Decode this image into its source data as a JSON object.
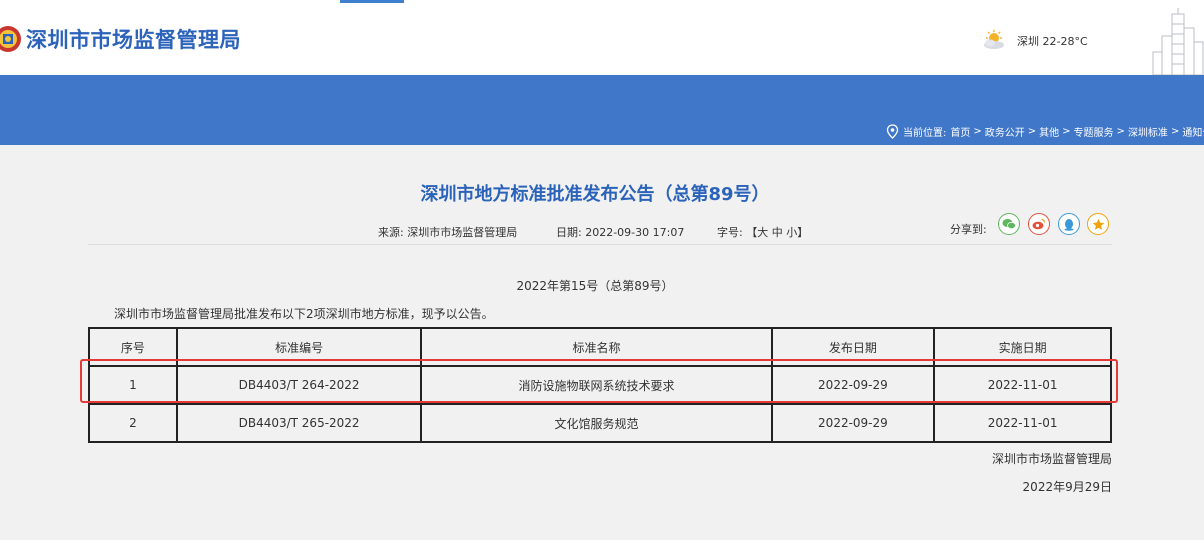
{
  "header": {
    "site_title": "深圳市市场监督管理局",
    "weather": "深圳 22-28°C"
  },
  "breadcrumb": {
    "label": "当前位置:",
    "items": [
      "首页",
      "政务公开",
      "其他",
      "专题服务",
      "深圳标准",
      "通知公告"
    ],
    "separator": ">"
  },
  "article": {
    "title": "深圳市地方标准批准发布公告（总第89号）",
    "source": "来源:  深圳市市场监督管理局",
    "date": "日期:  2022-09-30 17:07",
    "font_size_label": "字号:  【大   中   小】",
    "share_label": "分享到:",
    "issue": "2022年第15号（总第89号）",
    "intro": "深圳市市场监督管理局批准发布以下2项深圳市地方标准，现予以公告。",
    "sign_org": "深圳市市场监督管理局",
    "sign_date": "2022年9月29日"
  },
  "table": {
    "headers": [
      "序号",
      "标准编号",
      "标准名称",
      "发布日期",
      "实施日期"
    ],
    "rows": [
      [
        "1",
        "DB4403/T 264-2022",
        "消防设施物联网系统技术要求",
        "2022-09-29",
        "2022-11-01"
      ],
      [
        "2",
        "DB4403/T 265-2022",
        "文化馆服务规范",
        "2022-09-29",
        "2022-11-01"
      ]
    ]
  },
  "colors": {
    "brand_blue": "#2b63ba",
    "banner_blue": "#4077c9",
    "highlight_red": "#e53935",
    "wechat_green": "#5cb85c",
    "weibo_red": "#e2513b",
    "qq_blue": "#3a9ad9",
    "star_orange": "#f0a30a"
  },
  "icons": [
    "emblem-logo",
    "weather-sun-cloud-icon",
    "location-pin-icon",
    "wechat-icon",
    "weibo-icon",
    "qq-icon",
    "favorite-star-icon"
  ]
}
